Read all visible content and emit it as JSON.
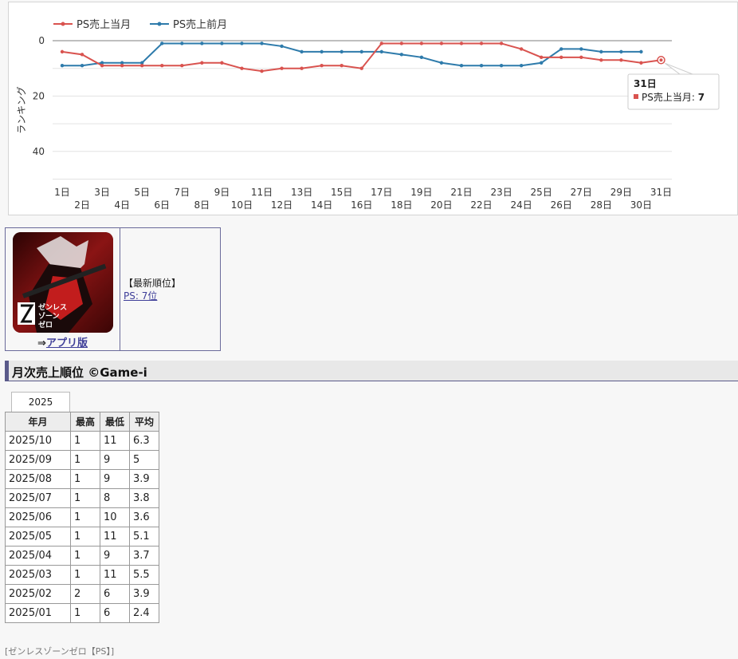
{
  "chart_data": {
    "type": "line",
    "x": [
      "1日",
      "2日",
      "3日",
      "4日",
      "5日",
      "6日",
      "7日",
      "8日",
      "9日",
      "10日",
      "11日",
      "12日",
      "13日",
      "14日",
      "15日",
      "16日",
      "17日",
      "18日",
      "19日",
      "20日",
      "21日",
      "22日",
      "23日",
      "24日",
      "25日",
      "26日",
      "27日",
      "28日",
      "29日",
      "30日",
      "31日"
    ],
    "series": [
      {
        "name": "PS売上当月",
        "color": "#d9534f",
        "values": [
          4,
          5,
          9,
          9,
          9,
          9,
          9,
          8,
          8,
          10,
          11,
          10,
          10,
          9,
          9,
          10,
          1,
          1,
          1,
          1,
          1,
          1,
          1,
          3,
          6,
          6,
          6,
          7,
          7,
          8,
          7
        ]
      },
      {
        "name": "PS売上前月",
        "color": "#2e7bab",
        "values": [
          9,
          9,
          8,
          8,
          8,
          1,
          1,
          1,
          1,
          1,
          1,
          2,
          4,
          4,
          4,
          4,
          4,
          5,
          6,
          8,
          9,
          9,
          9,
          9,
          8,
          3,
          3,
          4,
          4,
          4,
          null
        ]
      }
    ],
    "ylabel": "ランキング",
    "yticks": [
      0,
      20,
      40
    ],
    "ylim": [
      0,
      50
    ],
    "y_reversed": true,
    "legend": "top-left",
    "tooltip": {
      "title": "31日",
      "series": "PS売上当月",
      "value": "7"
    }
  },
  "app_box": {
    "icon_text": "ゼンレス\nゾーン\nゼロ",
    "link_prefix": "⇒",
    "link_label": "アプリ版",
    "latest_heading": "【最新順位】",
    "latest_rank": "PS: 7位"
  },
  "section": {
    "title": "月次売上順位 ©Game-i"
  },
  "table": {
    "year_tab": "2025",
    "headers": [
      "年月",
      "最高",
      "最低",
      "平均"
    ],
    "rows": [
      [
        "2025/10",
        "1",
        "11",
        "6.3"
      ],
      [
        "2025/09",
        "1",
        "9",
        "5"
      ],
      [
        "2025/08",
        "1",
        "9",
        "3.9"
      ],
      [
        "2025/07",
        "1",
        "8",
        "3.8"
      ],
      [
        "2025/06",
        "1",
        "10",
        "3.6"
      ],
      [
        "2025/05",
        "1",
        "11",
        "5.1"
      ],
      [
        "2025/04",
        "1",
        "9",
        "3.7"
      ],
      [
        "2025/03",
        "1",
        "11",
        "5.5"
      ],
      [
        "2025/02",
        "2",
        "6",
        "3.9"
      ],
      [
        "2025/01",
        "1",
        "6",
        "2.4"
      ]
    ]
  },
  "footer": {
    "breadcrumb": "[ゼンレスゾーンゼロ【PS】]"
  }
}
